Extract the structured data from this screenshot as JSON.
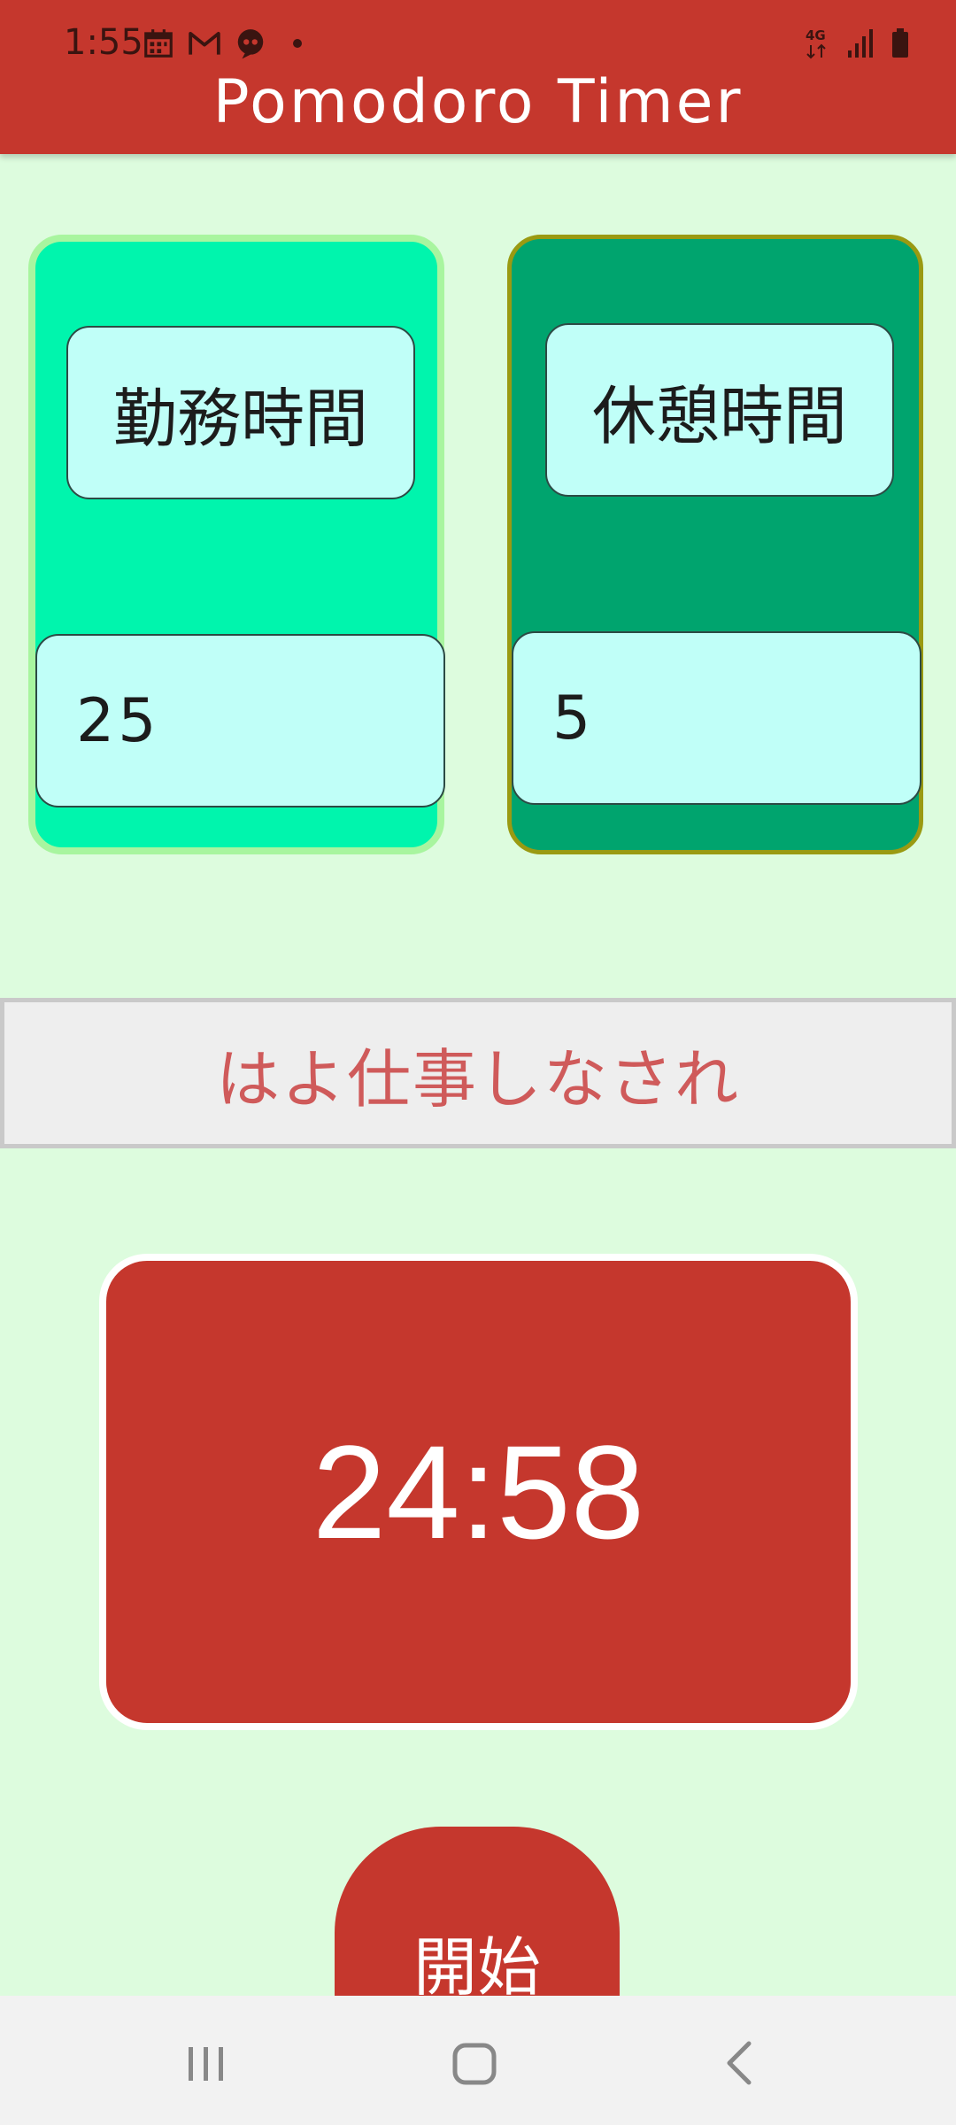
{
  "status_bar": {
    "time": "1:55",
    "left_icons": [
      "calendar-icon",
      "gmail-icon",
      "chat-icon",
      "notification-dot-icon"
    ],
    "right_icons": [
      "4g-data-icon",
      "signal-icon",
      "battery-icon"
    ]
  },
  "app_bar": {
    "title": "Pomodoro Timer"
  },
  "cards": {
    "work": {
      "label": "勤務時間",
      "value": "25"
    },
    "rest": {
      "label": "休憩時間",
      "value": "5"
    }
  },
  "message": {
    "text": "はよ仕事しなされ"
  },
  "timer": {
    "display": "24:58"
  },
  "start_button": {
    "label": "開始"
  },
  "nav_bar": {
    "items": [
      "recent-apps-icon",
      "home-icon",
      "back-icon"
    ]
  },
  "colors": {
    "primary": "#c5372d",
    "background": "#ddfcde",
    "work_card": "#00f5ad",
    "rest_card": "#00a46e",
    "field": "#c0fff8",
    "message_text": "#cf5a5a"
  }
}
